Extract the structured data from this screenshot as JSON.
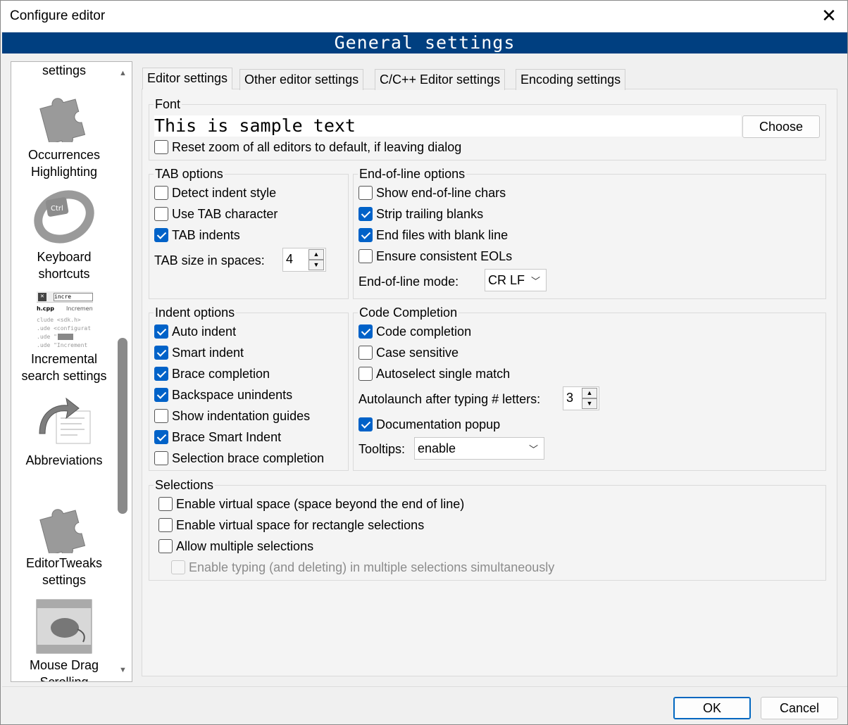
{
  "window": {
    "title": "Configure editor",
    "banner": "General settings"
  },
  "sidebar": {
    "items": [
      {
        "label": "settings"
      },
      {
        "label": "Occurrences\nHighlighting",
        "l1": "Occurrences",
        "l2": "Highlighting"
      },
      {
        "l1": "Keyboard",
        "l2": "shortcuts"
      },
      {
        "l1": "Incremental",
        "l2": "search settings"
      },
      {
        "l1": "Abbreviations"
      },
      {
        "l1": "EditorTweaks",
        "l2": "settings"
      },
      {
        "l1": "Mouse Drag",
        "l2": "Scrolling"
      }
    ],
    "incr_thumb": {
      "search": "incre",
      "file": "h.cpp",
      "tab2": "Increment",
      "line1": "clude <sdk.h>",
      "line2": ".ude <configurat",
      "line3": ".ude \"",
      "line4": ".ude \"Increment"
    },
    "kbd_key": "Ctrl"
  },
  "tabs": [
    "Editor settings",
    "Other editor settings",
    "C/C++ Editor settings",
    "Encoding settings"
  ],
  "font": {
    "group": "Font",
    "sample": "This is sample text",
    "choose": "Choose",
    "reset_zoom": "Reset zoom of all editors to default, if leaving dialog",
    "reset_zoom_checked": false
  },
  "tab_options": {
    "group": "TAB options",
    "detect": "Detect indent style",
    "use_tab": "Use TAB character",
    "tab_indents": "TAB indents",
    "size_label": "TAB size in spaces:",
    "size": "4"
  },
  "eol": {
    "group": "End-of-line options",
    "show": "Show end-of-line chars",
    "strip": "Strip trailing blanks",
    "end_files": "End files with blank line",
    "ensure": "Ensure consistent EOLs",
    "mode_label": "End-of-line mode:",
    "mode": "CR LF"
  },
  "indent": {
    "group": "Indent options",
    "auto": "Auto indent",
    "smart": "Smart indent",
    "brace": "Brace completion",
    "backspace": "Backspace unindents",
    "guides": "Show indentation guides",
    "brace_smart": "Brace Smart Indent",
    "sel_brace": "Selection brace completion"
  },
  "completion": {
    "group": "Code Completion",
    "code": "Code completion",
    "case": "Case sensitive",
    "autoselect": "Autoselect single match",
    "autolaunch_label": "Autolaunch after typing # letters:",
    "autolaunch": "3",
    "doc": "Documentation popup",
    "tooltips_label": "Tooltips:",
    "tooltips": "enable"
  },
  "selections": {
    "group": "Selections",
    "virtual": "Enable virtual space (space beyond the end of line)",
    "virtual_rect": "Enable virtual space for rectangle selections",
    "multiple": "Allow multiple selections",
    "typing": "Enable typing (and deleting) in multiple selections simultaneously"
  },
  "footer": {
    "ok": "OK",
    "cancel": "Cancel"
  },
  "colors": {
    "banner": "#003f80",
    "checked": "#0062c8"
  }
}
